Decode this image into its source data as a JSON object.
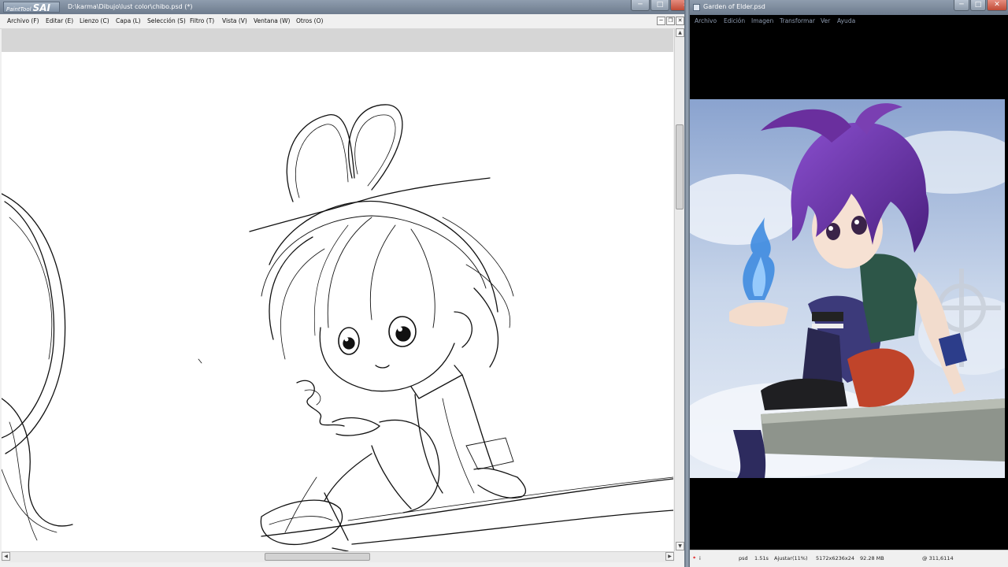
{
  "sai": {
    "logo_text": "PaintTool",
    "logo_bold": "SAI",
    "title": "D:\\karma\\Dibujo\\lust color\\chibo.psd (*)",
    "window_buttons": {
      "minimize": "─",
      "maximize": "□",
      "close": "✕"
    },
    "menu": [
      "Archivo (F)",
      "Editar (E)",
      "Lienzo (C)",
      "Capa (L)",
      "Selección (S)",
      "Filtro (T)",
      "Vista (V)",
      "Ventana (W)",
      "Otros (O)"
    ],
    "mdi_buttons": {
      "minimize": "─",
      "restore": "❐",
      "close": "✕"
    }
  },
  "viewer": {
    "title": "Garden of Elder.psd",
    "window_buttons": {
      "minimize": "─",
      "maximize": "□",
      "close": "✕"
    },
    "menu": [
      "Archivo",
      "Edición",
      "Imagen",
      "Transformar",
      "Ver",
      "Ayuda"
    ],
    "status": {
      "mark": "*",
      "info": "i",
      "format": "psd",
      "time": "1.51s",
      "zoom": "Ajustar(11%)",
      "dimensions": "5172x6236x24",
      "size": "92.28 MB",
      "coords": "@ 311,6114"
    }
  },
  "colors": {
    "titlebar": "#7c8a9c",
    "close_button": "#c9503c",
    "viewer_background": "#000000",
    "hair": "#6a2f9e",
    "sky": "#9fb7d9",
    "flame": "#3f8ce0"
  },
  "icons": [
    "app-icon",
    "scroll-up-icon",
    "scroll-down-icon",
    "scroll-left-icon",
    "scroll-right-icon"
  ]
}
